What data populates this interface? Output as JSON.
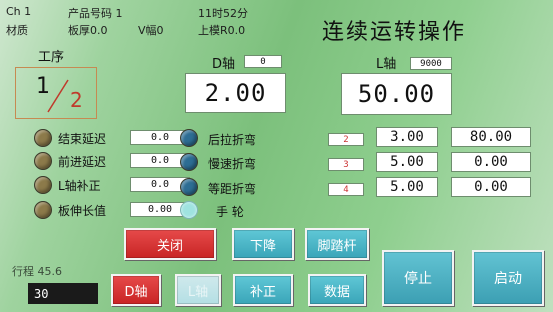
{
  "header": {
    "channel": "Ch 1",
    "material_label": "材质",
    "product_label": "产品号码 1",
    "thickness_label": "板厚0.0",
    "v_width_label": "V幅0",
    "time": "11时52分",
    "upper_die": "上模R0.0",
    "title": "连续运转操作"
  },
  "step": {
    "label": "工序",
    "current": "1",
    "total": "2"
  },
  "d_axis": {
    "label": "D轴",
    "small_value": "0",
    "value": "2.00"
  },
  "l_axis": {
    "label": "L轴",
    "small_value": "9000",
    "value": "50.00"
  },
  "left_params": [
    {
      "label": "结束延迟",
      "value": "0.0"
    },
    {
      "label": "前进延迟",
      "value": "0.0"
    },
    {
      "label": "L轴补正",
      "value": "0.0"
    },
    {
      "label": "板伸长值",
      "value": "0.00"
    }
  ],
  "mid_modes": [
    {
      "label": "后拉折弯"
    },
    {
      "label": "慢速折弯"
    },
    {
      "label": "等距折弯"
    },
    {
      "label": "手  轮"
    }
  ],
  "step_table": [
    {
      "index": "2",
      "a": "3.00",
      "b": "80.00"
    },
    {
      "index": "3",
      "a": "5.00",
      "b": "0.00"
    },
    {
      "index": "4",
      "a": "5.00",
      "b": "0.00"
    }
  ],
  "stroke": {
    "label": "行程 45.6",
    "value": "30"
  },
  "buttons": {
    "close": "关闭",
    "down": "下降",
    "foot_pedal": "脚踏杆",
    "d_axis": "D轴",
    "l_axis": "L轴",
    "correct": "补正",
    "data": "数据",
    "stop": "停止",
    "start": "启动"
  }
}
